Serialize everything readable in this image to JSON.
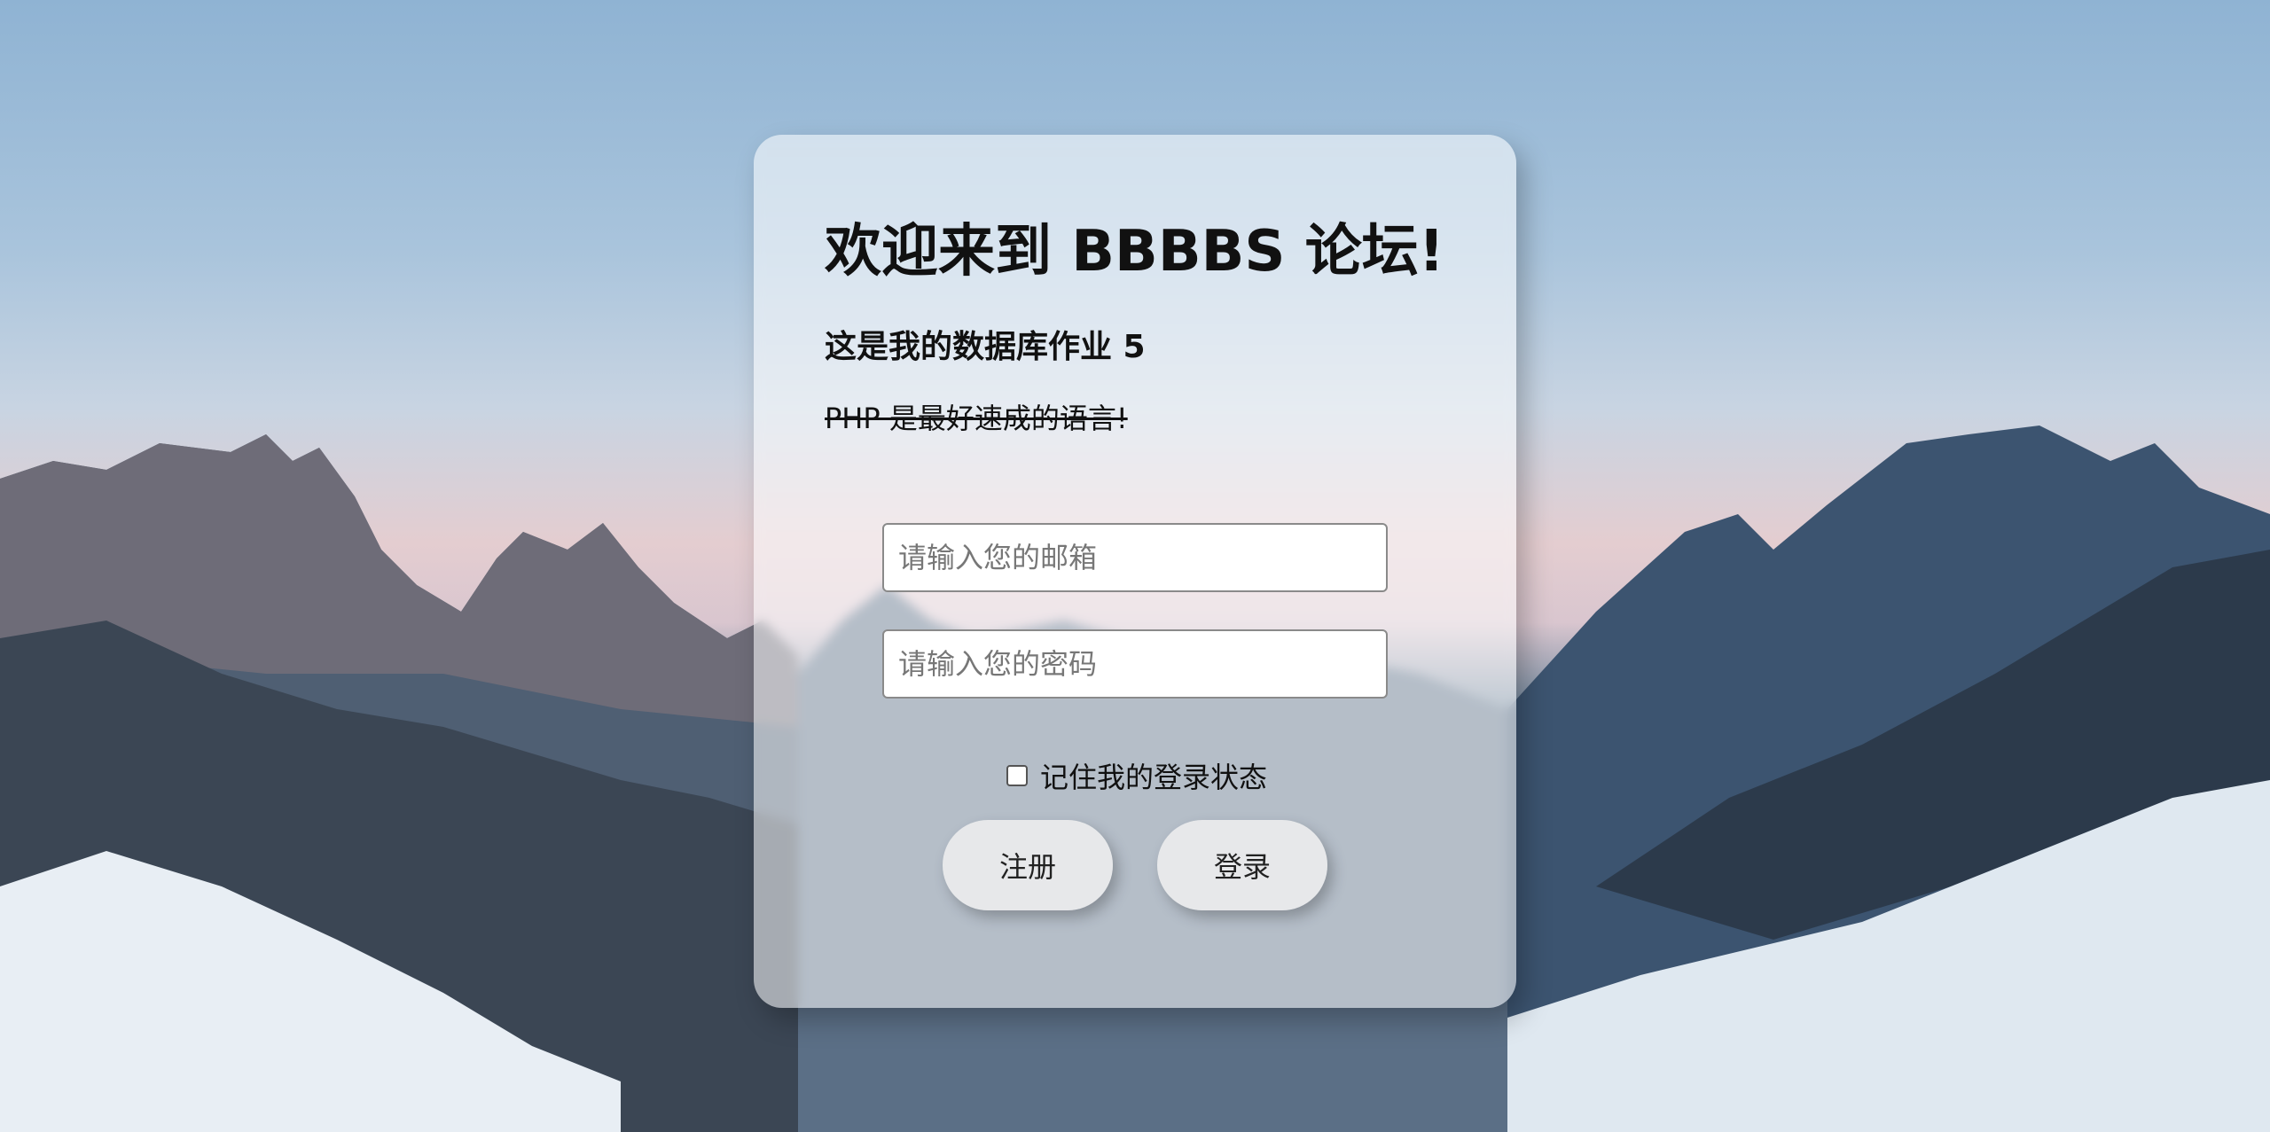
{
  "login_card": {
    "title": "欢迎来到 BBBBS 论坛!",
    "subtitle": "这是我的数据库作业 5",
    "tagline": "PHP 是最好速成的语言!",
    "email_placeholder": "请输入您的邮箱",
    "password_placeholder": "请输入您的密码",
    "remember_label": "记住我的登录状态",
    "register_label": "注册",
    "login_label": "登录"
  },
  "colors": {
    "card_background": "#ffffff",
    "text_primary": "#111111",
    "input_border": "#8a8a8a"
  }
}
